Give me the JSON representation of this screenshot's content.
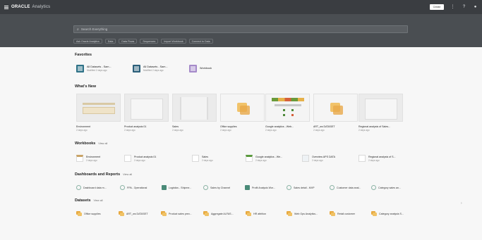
{
  "header": {
    "brand": "ORACLE",
    "product": "Analytics",
    "create_label": "Create"
  },
  "search": {
    "placeholder": "Search Everything"
  },
  "chips": [
    "Ask Oracle Analytics",
    "Data",
    "Data Flows",
    "Sequences",
    "Import Workbook",
    "Connect to Data"
  ],
  "favorites": {
    "title": "Favorites",
    "items": [
      {
        "name": "All Datasets - Sam...",
        "meta": "Modified 2 days ago",
        "color": "#2e7287"
      },
      {
        "name": "All Datasets - Sam...",
        "meta": "Modified 2 days ago",
        "color": "#2b5f7a"
      },
      {
        "name": "Workbook",
        "meta": "",
        "color": "#a58ac9"
      }
    ]
  },
  "whats_new": {
    "title": "What's New",
    "cards": [
      {
        "title": "Environment",
        "meta": "2 days ago"
      },
      {
        "title": "Product analysis 01",
        "meta": "2 days ago"
      },
      {
        "title": "Sales",
        "meta": "2 days ago"
      },
      {
        "title": "Office supplies",
        "meta": "2 days ago"
      },
      {
        "title": "Google analytics - Web...",
        "meta": "2 days ago"
      },
      {
        "title": "ART_ws DATASET",
        "meta": "2 days ago"
      },
      {
        "title": "Regional analysis of Sales...",
        "meta": "2 days ago"
      }
    ]
  },
  "workbooks": {
    "title": "Workbooks",
    "view_all": "View all",
    "items": [
      {
        "name": "Environment",
        "meta": "2 days ago"
      },
      {
        "name": "Product analysis 01",
        "meta": "2 days ago"
      },
      {
        "name": "Sales",
        "meta": "2 days ago"
      },
      {
        "name": "Google analytics - We...",
        "meta": "2 days ago"
      },
      {
        "name": "Overview APS DATA",
        "meta": "2 days ago"
      },
      {
        "name": "Regional analysis of S...",
        "meta": "2 days ago"
      }
    ]
  },
  "reports": {
    "title": "Dashboards and Reports",
    "view_all": "View all",
    "items": [
      {
        "name": "Dashboard data m...",
        "square": false
      },
      {
        "name": "FPA - Operational",
        "square": false
      },
      {
        "name": "Logistics - Shipme...",
        "square": true
      },
      {
        "name": "Sales by Channel",
        "square": false
      },
      {
        "name": "Profit Analysis Wor...",
        "square": true
      },
      {
        "name": "Sales detail - MVP",
        "square": false
      },
      {
        "name": "Customer data anal...",
        "square": false
      },
      {
        "name": "Category sales an...",
        "square": false
      }
    ]
  },
  "datasets": {
    "title": "Datasets",
    "view_all": "View all",
    "items": [
      {
        "name": "Office supplies"
      },
      {
        "name": "ART_ws DATASET"
      },
      {
        "name": "Product sales prev..."
      },
      {
        "name": "Aggregate ALFAS..."
      },
      {
        "name": "HR attrition"
      },
      {
        "name": "Web Ops Analytics..."
      },
      {
        "name": "Retail customer"
      },
      {
        "name": "Category analysis S..."
      }
    ]
  }
}
